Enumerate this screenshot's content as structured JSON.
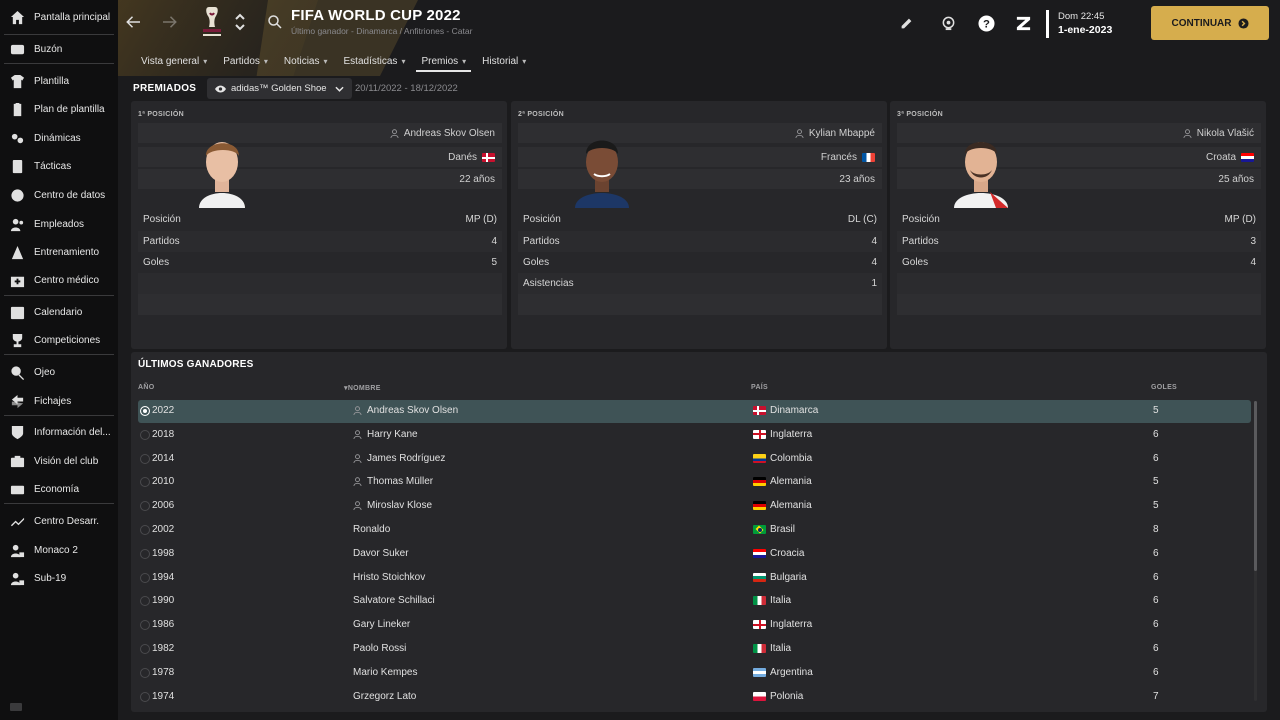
{
  "sidebar": {
    "items": [
      {
        "label": "Pantalla principal",
        "icon": "home-icon"
      },
      {
        "label": "Buzón",
        "icon": "inbox-icon"
      },
      {
        "label": "Plantilla",
        "icon": "shirt-icon"
      },
      {
        "label": "Plan de plantilla",
        "icon": "clipboard-icon"
      },
      {
        "label": "Dinámicas",
        "icon": "dynamics-icon"
      },
      {
        "label": "Tácticas",
        "icon": "tactics-icon"
      },
      {
        "label": "Centro de datos",
        "icon": "data-icon"
      },
      {
        "label": "Empleados",
        "icon": "staff-icon"
      },
      {
        "label": "Entrenamiento",
        "icon": "training-icon"
      },
      {
        "label": "Centro médico",
        "icon": "medical-icon"
      },
      {
        "label": "Calendario",
        "icon": "calendar-icon"
      },
      {
        "label": "Competiciones",
        "icon": "trophy-icon"
      },
      {
        "label": "Ojeo",
        "icon": "scouting-icon"
      },
      {
        "label": "Fichajes",
        "icon": "transfers-icon"
      },
      {
        "label": "Información del...",
        "icon": "club-info-icon"
      },
      {
        "label": "Visión del club",
        "icon": "club-vision-icon"
      },
      {
        "label": "Economía",
        "icon": "finances-icon"
      },
      {
        "label": "Centro Desarr.",
        "icon": "development-icon"
      },
      {
        "label": "Monaco 2",
        "icon": "reserve-team-icon"
      },
      {
        "label": "Sub-19",
        "icon": "youth-team-icon"
      }
    ]
  },
  "header": {
    "title": "FIFA WORLD CUP 2022",
    "subtitle": "Último ganador - Dinamarca / Anfitriones - Catar",
    "date_day": "Dom 22:45",
    "date_date": "1-ene-2023",
    "continue_label": "CONTINUAR",
    "tabs": [
      {
        "label": "Vista general"
      },
      {
        "label": "Partidos"
      },
      {
        "label": "Noticias"
      },
      {
        "label": "Estadísticas"
      },
      {
        "label": "Premios"
      },
      {
        "label": "Historial"
      }
    ],
    "active_tab": "Premios"
  },
  "awards": {
    "section_label": "PREMIADOS",
    "selected_award": "adidas™ Golden Shoe",
    "date_range": "20/11/2022 - 18/12/2022"
  },
  "podium": [
    {
      "position": "1ª POSICIÓN",
      "name": "Andreas Skov Olsen",
      "nationality": "Danés",
      "age": "22 años",
      "stats": [
        {
          "label": "Posición",
          "value": "MP (D)"
        },
        {
          "label": "Partidos",
          "value": "4"
        },
        {
          "label": "Goles",
          "value": "5"
        }
      ]
    },
    {
      "position": "2ª POSICIÓN",
      "name": "Kylian Mbappé",
      "nationality": "Francés",
      "age": "23 años",
      "stats": [
        {
          "label": "Posición",
          "value": "DL (C)"
        },
        {
          "label": "Partidos",
          "value": "4"
        },
        {
          "label": "Goles",
          "value": "4"
        },
        {
          "label": "Asistencias",
          "value": "1"
        }
      ]
    },
    {
      "position": "3ª POSICIÓN",
      "name": "Nikola Vlašić",
      "nationality": "Croata",
      "age": "25 años",
      "stats": [
        {
          "label": "Posición",
          "value": "MP (D)"
        },
        {
          "label": "Partidos",
          "value": "3"
        },
        {
          "label": "Goles",
          "value": "4"
        }
      ]
    }
  ],
  "winners": {
    "title": "ÚLTIMOS GANADORES",
    "columns": {
      "year": "AÑO",
      "name": "NOMBRE",
      "country": "PAÍS",
      "goals": "GOLES"
    },
    "rows": [
      {
        "year": "2022",
        "name": "Andreas Skov Olsen",
        "country": "Dinamarca",
        "goals": "5"
      },
      {
        "year": "2018",
        "name": "Harry Kane",
        "country": "Inglaterra",
        "goals": "6"
      },
      {
        "year": "2014",
        "name": "James Rodríguez",
        "country": "Colombia",
        "goals": "6"
      },
      {
        "year": "2010",
        "name": "Thomas Müller",
        "country": "Alemania",
        "goals": "5"
      },
      {
        "year": "2006",
        "name": "Miroslav Klose",
        "country": "Alemania",
        "goals": "5"
      },
      {
        "year": "2002",
        "name": "Ronaldo",
        "country": "Brasil",
        "goals": "8"
      },
      {
        "year": "1998",
        "name": "Davor Suker",
        "country": "Croacia",
        "goals": "6"
      },
      {
        "year": "1994",
        "name": "Hristo Stoichkov",
        "country": "Bulgaria",
        "goals": "6"
      },
      {
        "year": "1990",
        "name": "Salvatore Schillaci",
        "country": "Italia",
        "goals": "6"
      },
      {
        "year": "1986",
        "name": "Gary Lineker",
        "country": "Inglaterra",
        "goals": "6"
      },
      {
        "year": "1982",
        "name": "Paolo Rossi",
        "country": "Italia",
        "goals": "6"
      },
      {
        "year": "1978",
        "name": "Mario Kempes",
        "country": "Argentina",
        "goals": "6"
      },
      {
        "year": "1974",
        "name": "Grzegorz Lato",
        "country": "Polonia",
        "goals": "7"
      }
    ]
  },
  "colors": {
    "accent_gold": "#d6ad4d",
    "selected_row": "#3f5356",
    "panel_bg": "#27272a",
    "sidebar_bg": "#0f0f10"
  }
}
